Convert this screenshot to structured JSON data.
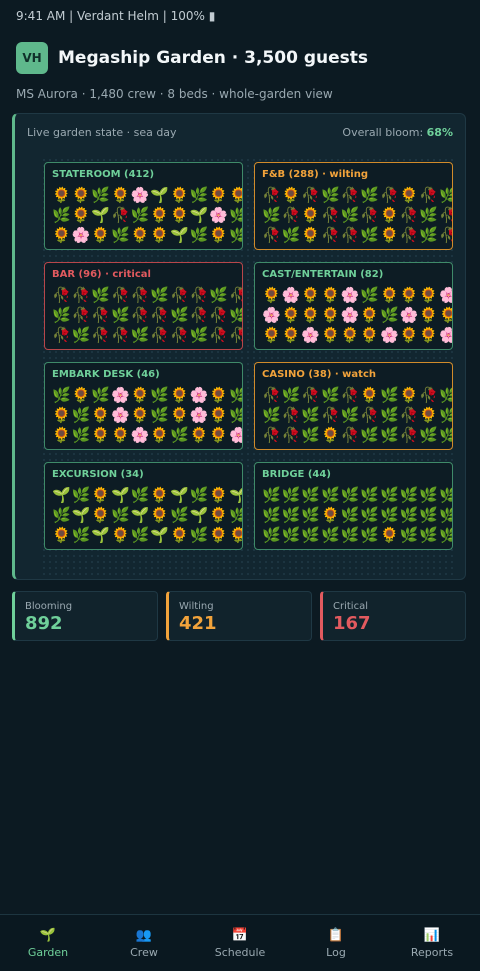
{
  "status_bar": {
    "text": "9:41 AM | Verdant Helm | 100% ▮"
  },
  "header": {
    "avatar": "VH",
    "title": "Megaship Garden · 3,500 guests",
    "subtitle": "MS Aurora · 1,480 crew · 8 beds · whole-garden view"
  },
  "garden": {
    "state_label": "Live garden state · sea day",
    "bloom_label": "Overall bloom: ",
    "bloom_value": "68%",
    "zones": [
      {
        "title": "STATEROOM (412)",
        "status": "healthy",
        "rows": [
          "🌻🌻🌿🌻🌸🌱🌻🌿🌻🌻",
          "🌿🌻🌱🥀🌿🌻🌻🌱🌸🌿",
          "🌻🌸🌻🌿🌻🌻🌱🌿🌻🌿"
        ]
      },
      {
        "title": "F&B (288) · wilting",
        "status": "wilting",
        "rows": [
          "🥀🌻🥀🌿🥀🌿🥀🌻🥀🌿",
          "🌿🥀🌻🥀🌿🥀🌻🥀🌿🥀",
          "🥀🌿🌻🥀🥀🌿🌻🥀🌿🥀"
        ]
      },
      {
        "title": "BAR (96) · critical",
        "status": "critical",
        "rows": [
          "🥀🥀🌿🥀🥀🌿🥀🥀🌿🥀",
          "🌿🥀🥀🌿🥀🥀🌿🥀🥀🌿",
          "🥀🌿🥀🥀🌿🥀🥀🌿🥀🥀"
        ]
      },
      {
        "title": "CAST/ENTERTAIN (82)",
        "status": "healthy",
        "rows": [
          "🌻🌸🌻🌻🌸🌿🌻🌻🌻🌸",
          "🌸🌻🌻🌻🌸🌻🌿🌸🌻🌻",
          "🌻🌻🌸🌻🌻🌻🌸🌻🌻🌸"
        ]
      },
      {
        "title": "EMBARK DESK (46)",
        "status": "healthy",
        "rows": [
          "🌿🌻🌿🌸🌻🌿🌻🌸🌻🌿",
          "🌻🌿🌻🌸🌻🌿🌻🌸🌻🌿",
          "🌻🌿🌻🌻🌸🌻🌿🌻🌻🌸"
        ]
      },
      {
        "title": "CASINO (38) · watch",
        "status": "wilting",
        "rows": [
          "🥀🌿🥀🌿🥀🌻🌿🌻🥀🌿",
          "🌿🥀🌿🥀🌿🥀🌿🥀🌻🌿",
          "🥀🥀🌿🌻🥀🌿🌿🥀🌿🌿"
        ]
      },
      {
        "title": "EXCURSION (34)",
        "status": "healthy",
        "rows": [
          "🌱🌿🌻🌱🌿🌻🌱🌿🌻🌱",
          "🌿🌱🌻🌿🌱🌻🌿🌱🌻🌿",
          "🌻🌿🌱🌻🌿🌱🌻🌿🌻🌻"
        ]
      },
      {
        "title": "BRIDGE (44)",
        "status": "healthy",
        "rows": [
          "🌿🌿🌿🌿🌿🌿🌿🌿🌿🌿",
          "🌿🌿🌿🌻🌿🌿🌿🌿🌿🌿",
          "🌿🌿🌿🌿🌿🌿🌻🌿🌿🌿"
        ]
      }
    ]
  },
  "stats": [
    {
      "label": "Blooming",
      "value": "892",
      "color": "#6fd09a"
    },
    {
      "label": "Wilting",
      "value": "421",
      "color": "#f2a33b"
    },
    {
      "label": "Critical",
      "value": "167",
      "color": "#e25a5f"
    }
  ],
  "nav": [
    {
      "icon": "🌱",
      "icon_name": "sprout-icon",
      "label": "Garden"
    },
    {
      "icon": "👥",
      "icon_name": "people-icon",
      "label": "Crew"
    },
    {
      "icon": "📅",
      "icon_name": "calendar-icon",
      "label": "Schedule"
    },
    {
      "icon": "📋",
      "icon_name": "clipboard-icon",
      "label": "Log"
    },
    {
      "icon": "📊",
      "icon_name": "bar-chart-icon",
      "label": "Reports"
    }
  ]
}
